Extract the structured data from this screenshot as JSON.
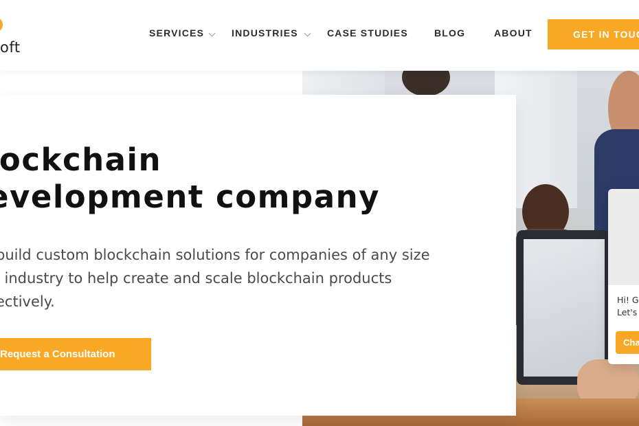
{
  "header": {
    "logo_text": "oft",
    "nav": [
      {
        "label": "SERVICES",
        "has_dropdown": true
      },
      {
        "label": "INDUSTRIES",
        "has_dropdown": true
      },
      {
        "label": "CASE STUDIES",
        "has_dropdown": false
      },
      {
        "label": "BLOG",
        "has_dropdown": false
      },
      {
        "label": "ABOUT",
        "has_dropdown": false
      }
    ],
    "cta_label": "GET IN TOUC"
  },
  "hero": {
    "title_lines": [
      "lockchain",
      "evelopment company"
    ],
    "subtitle_lines": [
      "build custom blockchain solutions for companies of any size",
      "l industry to help create and scale blockchain products",
      "ectively."
    ],
    "button_label": "Request a Consultation"
  },
  "chat": {
    "message_lines": [
      "Hi! G",
      "Let's"
    ],
    "button_label": "Cha"
  },
  "colors": {
    "accent": "#f8a825",
    "text_dark": "#111111",
    "text_body": "#4a4a4a"
  }
}
